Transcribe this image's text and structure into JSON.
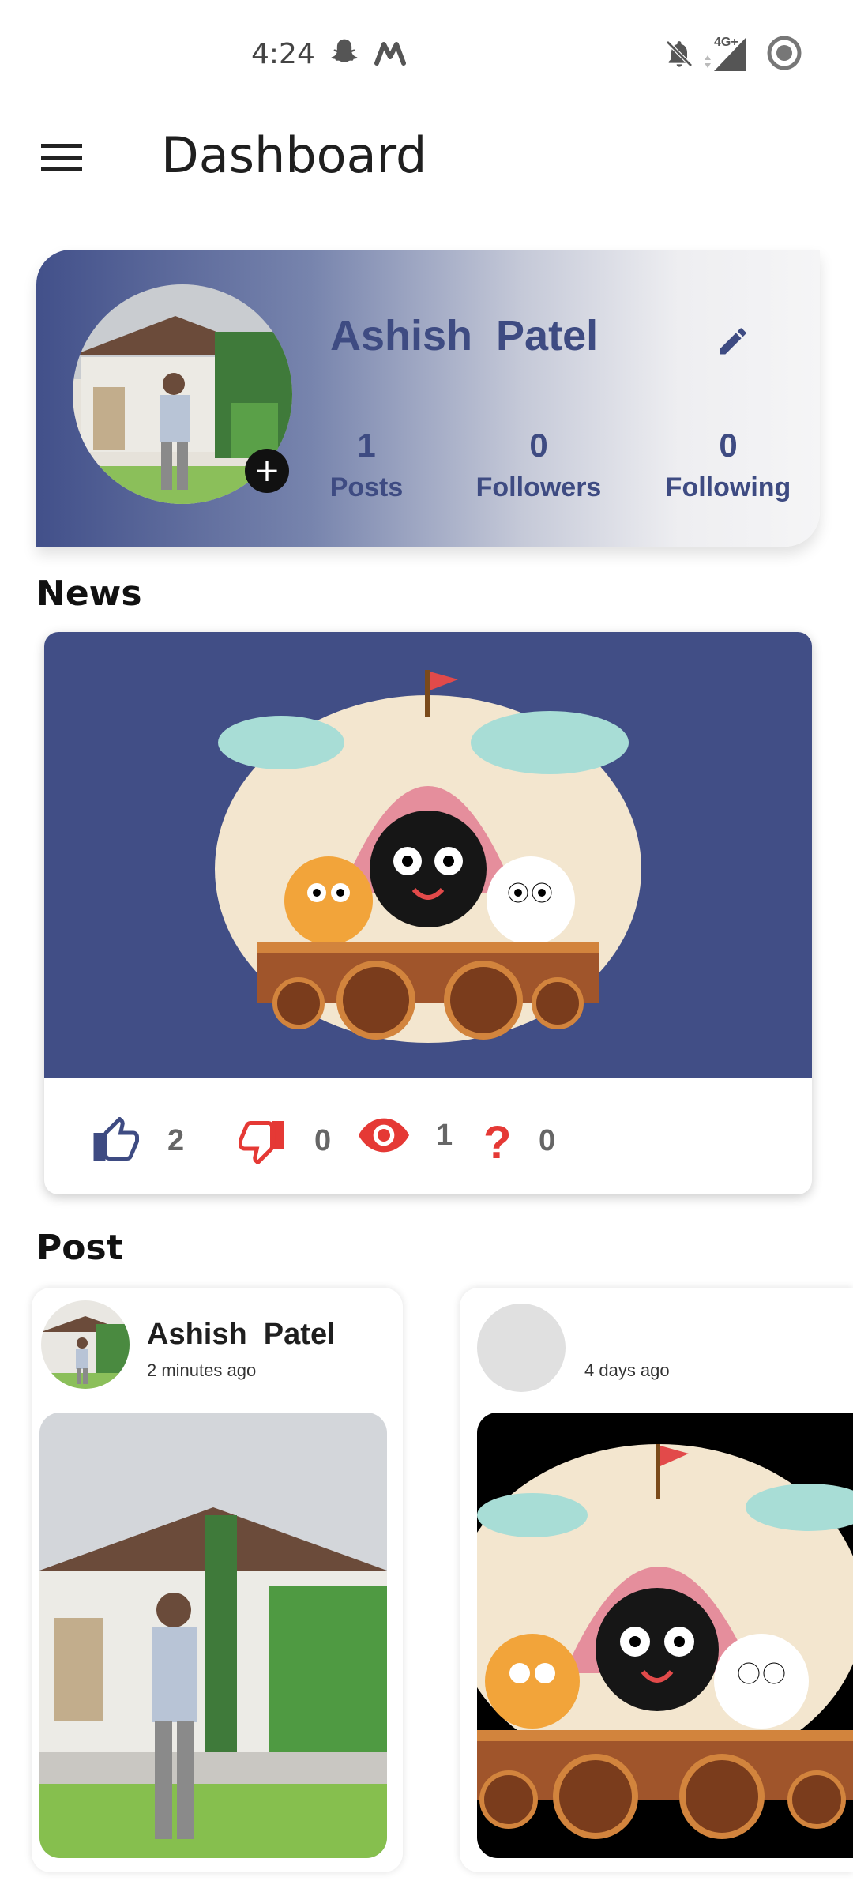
{
  "status_bar": {
    "time": "4:24",
    "network": "4G+",
    "icons": [
      "snapchat-icon",
      "m-app-icon",
      "bell-off-icon",
      "signal-icon",
      "record-icon"
    ]
  },
  "app_bar": {
    "title": "Dashboard",
    "menu_icon": "hamburger-menu-icon"
  },
  "profile": {
    "name": "Ashish  Patel",
    "add_label": "+",
    "stats": [
      {
        "value": "1",
        "label": "Posts"
      },
      {
        "value": "0",
        "label": "Followers"
      },
      {
        "value": "0",
        "label": "Following"
      }
    ]
  },
  "news": {
    "heading": "News",
    "reactions": {
      "likes": "2",
      "dislikes": "0",
      "views": "1",
      "questions": "0"
    }
  },
  "posts": {
    "heading": "Post",
    "items": [
      {
        "author": "Ashish  Patel",
        "time": "2 minutes ago"
      },
      {
        "author": "",
        "time": "4 days ago"
      }
    ]
  },
  "colors": {
    "accent": "#3e4b82",
    "news_bg": "#414e86",
    "dislike_red": "#e53935"
  }
}
